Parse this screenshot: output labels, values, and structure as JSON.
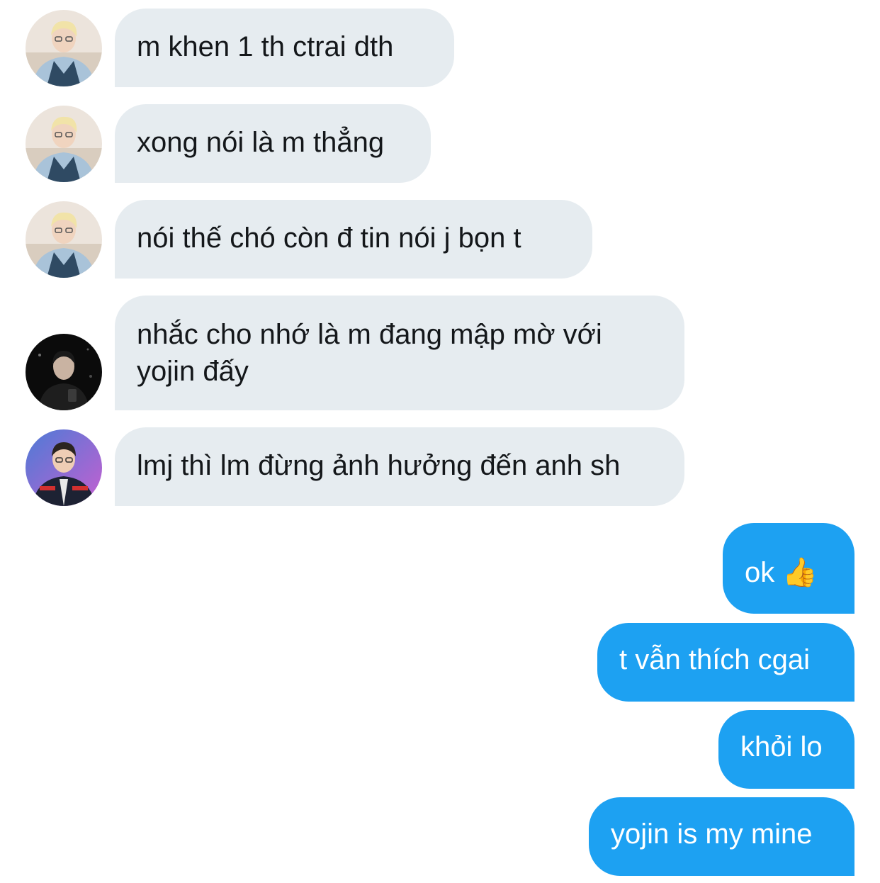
{
  "conversation": {
    "incoming": [
      {
        "text": "m khen 1 th ctrai dth",
        "avatar": "avatar-blond"
      },
      {
        "text": "xong nói là m thẳng",
        "avatar": "avatar-blond"
      },
      {
        "text": "nói thế chó còn đ tin nói j bọn t",
        "avatar": "avatar-blond"
      },
      {
        "text": "nhắc cho nhớ là m đang mập mờ với yojin đấy",
        "avatar": "avatar-dark"
      },
      {
        "text": "lmj thì lm đừng ảnh hưởng đến anh sh",
        "avatar": "avatar-jersey"
      }
    ],
    "outgoing": [
      {
        "text": "ok",
        "emoji": "👍"
      },
      {
        "text": "t vẫn thích cgai"
      },
      {
        "text": "khỏi lo"
      },
      {
        "text": "yojin is my mine"
      }
    ]
  },
  "colors": {
    "incoming_bubble": "#e6ecf0",
    "outgoing_bubble": "#1da1f2",
    "incoming_text": "#14171a",
    "outgoing_text": "#ffffff"
  }
}
